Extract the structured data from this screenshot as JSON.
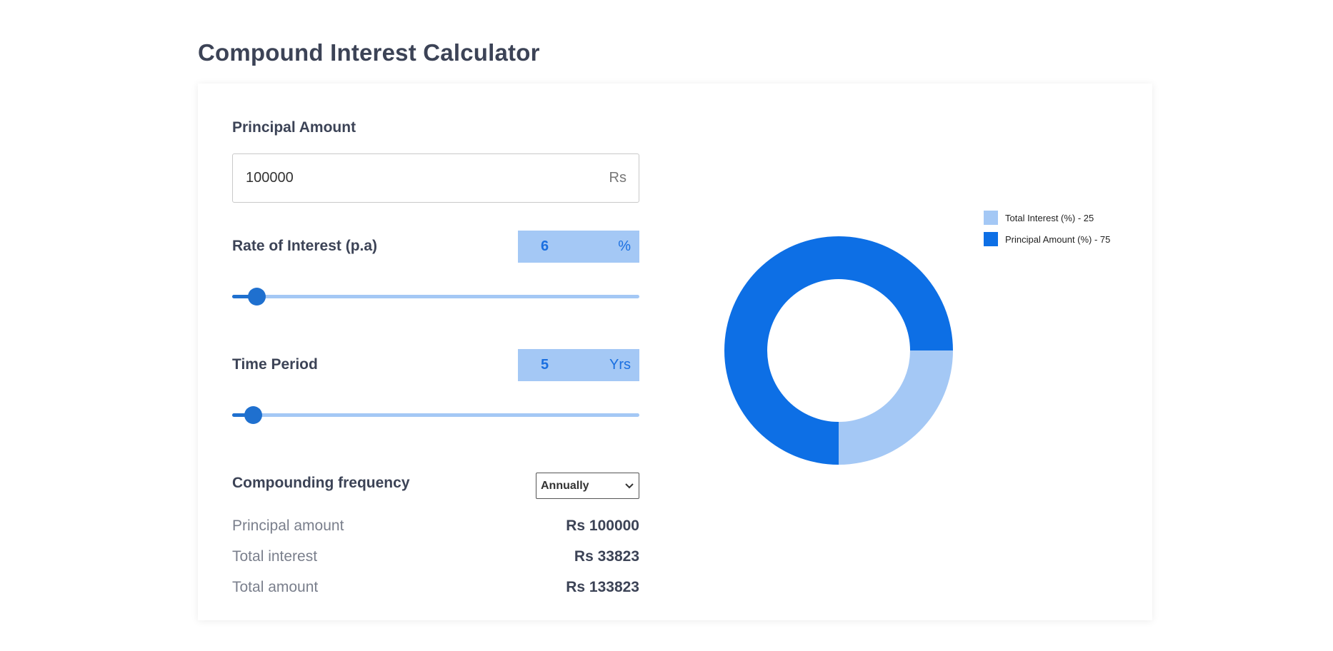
{
  "title": "Compound Interest Calculator",
  "principal": {
    "label": "Principal Amount",
    "value": "100000",
    "unit": "Rs"
  },
  "rate": {
    "label": "Rate of Interest (p.a)",
    "value": "6",
    "unit": "%",
    "slider_fraction": 0.06
  },
  "time": {
    "label": "Time Period",
    "value": "5",
    "unit": "Yrs",
    "slider_fraction": 0.05
  },
  "frequency": {
    "label": "Compounding frequency",
    "selected": "Annually"
  },
  "summary": {
    "principal_label": "Principal amount",
    "principal_value": "Rs 100000",
    "interest_label": "Total interest",
    "interest_value": "Rs 33823",
    "total_label": "Total amount",
    "total_value": "Rs 133823"
  },
  "colors": {
    "interest": "#a4c8f5",
    "principal": "#0d6fe5",
    "accent": "#1f70cf"
  },
  "chart_data": {
    "type": "pie",
    "variant": "donut",
    "legend_position": "top-right",
    "categories": [
      "Total Interest (%) - 25",
      "Principal Amount (%) - 75"
    ],
    "values": [
      25,
      75
    ]
  }
}
